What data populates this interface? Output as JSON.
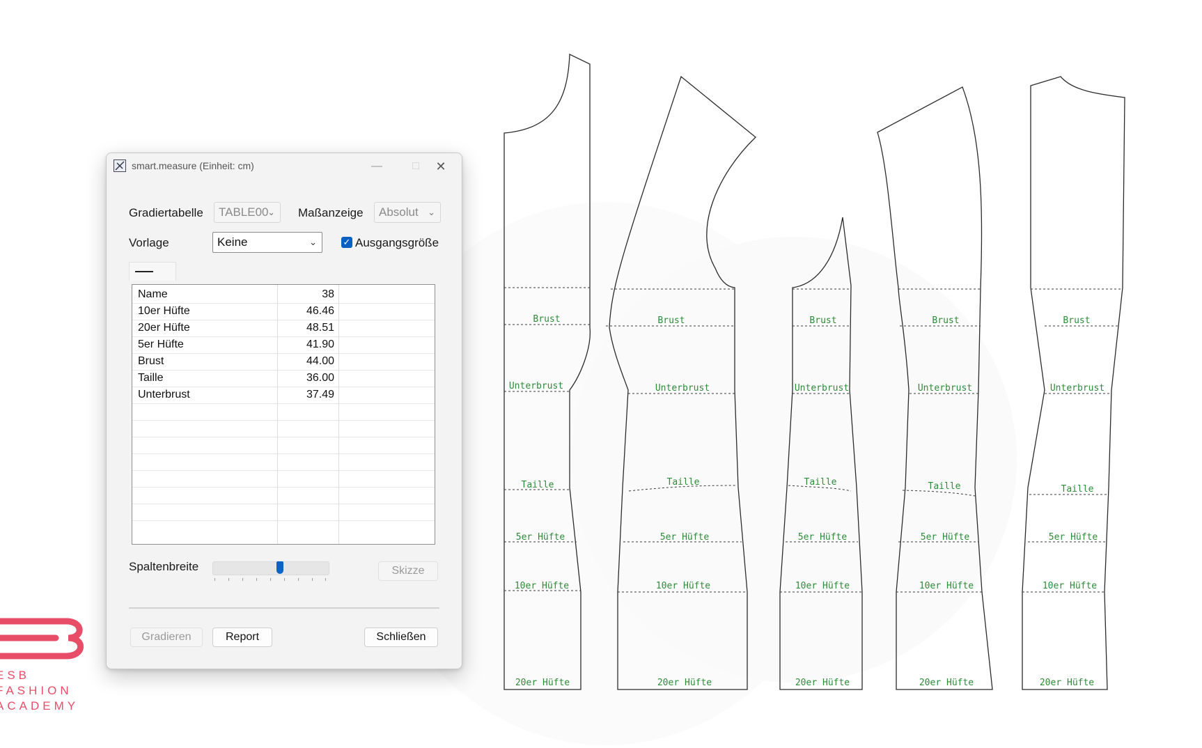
{
  "dialog": {
    "title": "smart.measure (Einheit: cm)",
    "window_controls": {
      "minimize": "—",
      "maximize": "□",
      "close": "✕"
    },
    "gradiertabelle_label": "Gradiertabelle",
    "gradiertabelle_value": "TABLE00",
    "massanzeige_label": "Maßanzeige",
    "massanzeige_value": "Absolut",
    "vorlage_label": "Vorlage",
    "vorlage_value": "Keine",
    "ausgangsgroesse_label": "Ausgangsgröße",
    "ausgangsgroesse_checked": true,
    "table": {
      "rows": [
        {
          "name": "Name",
          "value": "38"
        },
        {
          "name": "10er Hüfte",
          "value": "46.46"
        },
        {
          "name": "20er Hüfte",
          "value": "48.51"
        },
        {
          "name": "5er Hüfte",
          "value": "41.90"
        },
        {
          "name": "Brust",
          "value": "44.00"
        },
        {
          "name": "Taille",
          "value": "36.00"
        },
        {
          "name": "Unterbrust",
          "value": "37.49"
        }
      ]
    },
    "spaltenbreite_label": "Spaltenbreite",
    "spaltenbreite_level": 0.58,
    "skizze_button": "Skizze",
    "gradieren_button": "Gradieren",
    "report_button": "Report",
    "schliessen_button": "Schließen"
  },
  "pattern": {
    "line_labels": [
      "Brust",
      "Unterbrust",
      "Taille",
      "5er Hüfte",
      "10er Hüfte",
      "20er Hüfte"
    ]
  },
  "logo": {
    "line1": "ESB",
    "line2": "FASHION",
    "line3": "ACADEMY",
    "color": "#e84d68"
  },
  "colors": {
    "accent": "#0a64c8",
    "label_green": "#2e8b3a"
  }
}
